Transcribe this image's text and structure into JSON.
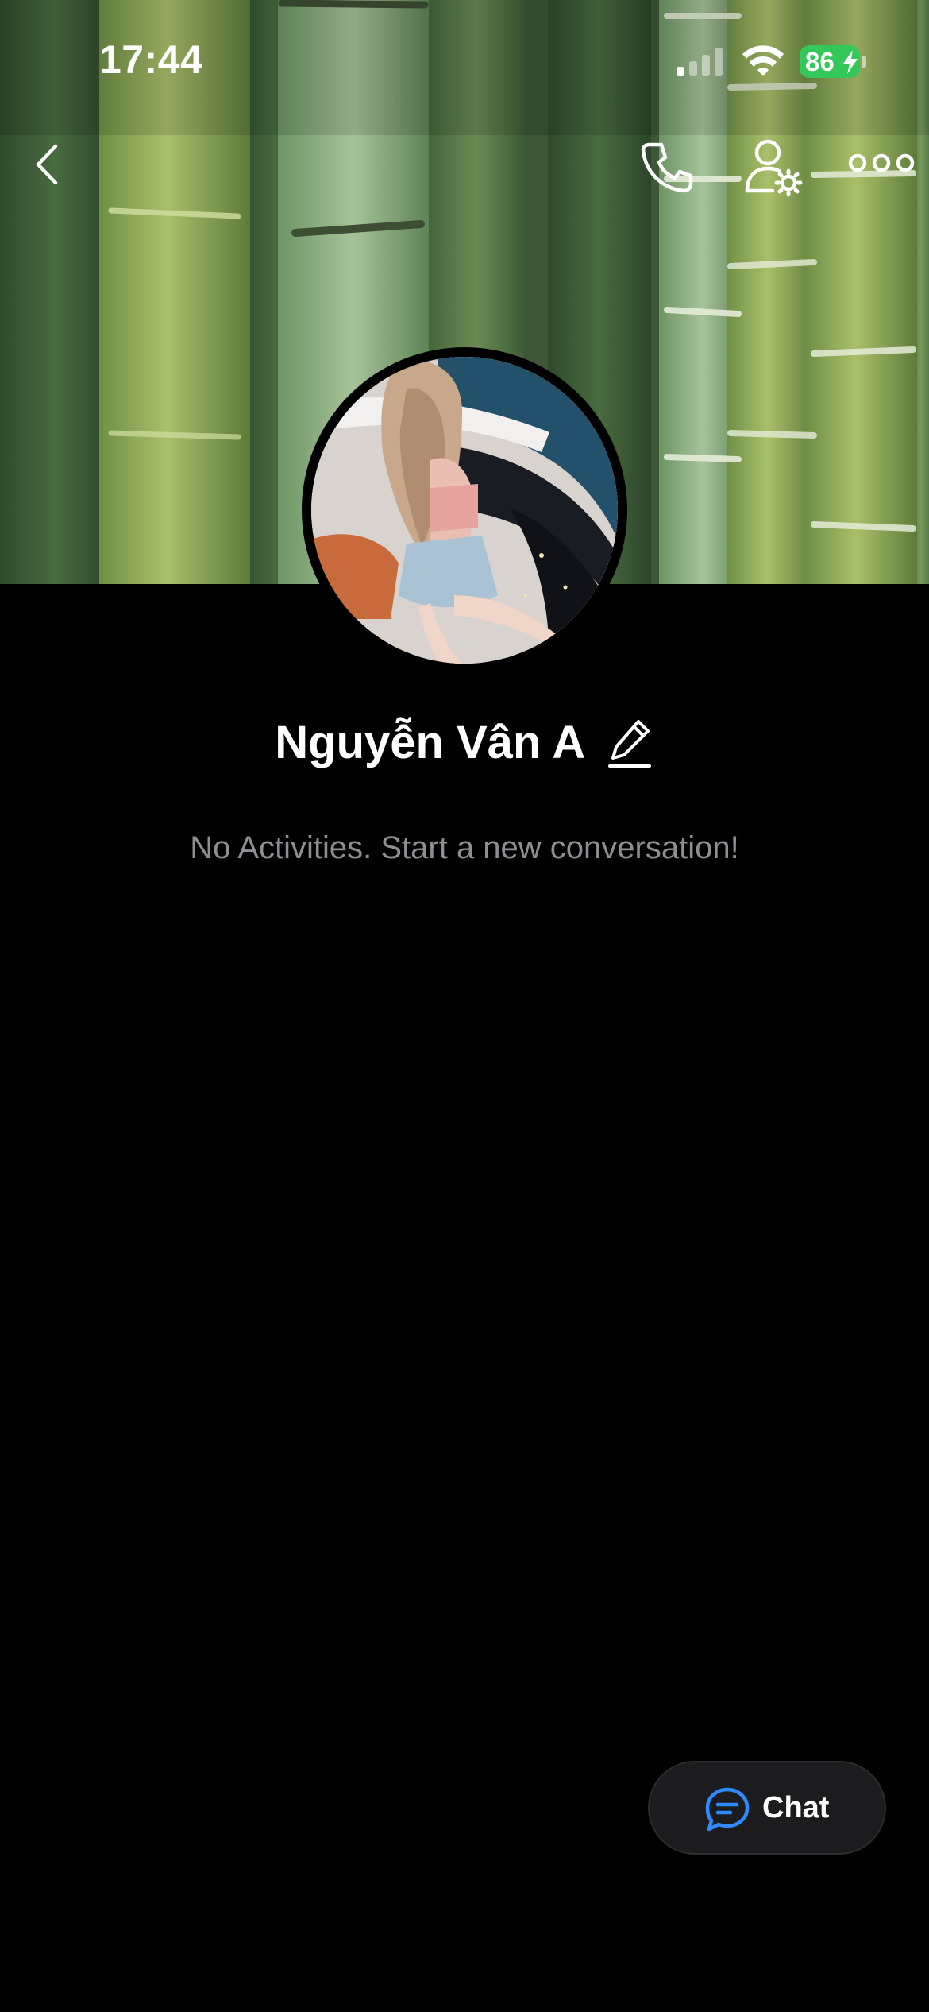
{
  "status_bar": {
    "time": "17:44",
    "battery_level": "86",
    "signal_bars_active": 1,
    "signal_bars_total": 4,
    "charging": true
  },
  "nav": {
    "back_icon": "chevron-left-icon",
    "call_icon": "phone-icon",
    "profile_settings_icon": "user-gear-icon",
    "more_icon": "more-horizontal-icon"
  },
  "profile": {
    "name": "Nguyễn Vân A",
    "edit_icon": "pencil-icon",
    "empty_message": "No Activities. Start a new conversation!"
  },
  "chat_button": {
    "label": "Chat",
    "icon": "chat-bubble-icon",
    "icon_color": "#2e8bff"
  },
  "colors": {
    "background": "#000000",
    "battery": "#34c759",
    "secondary_text": "#8e8e93"
  }
}
